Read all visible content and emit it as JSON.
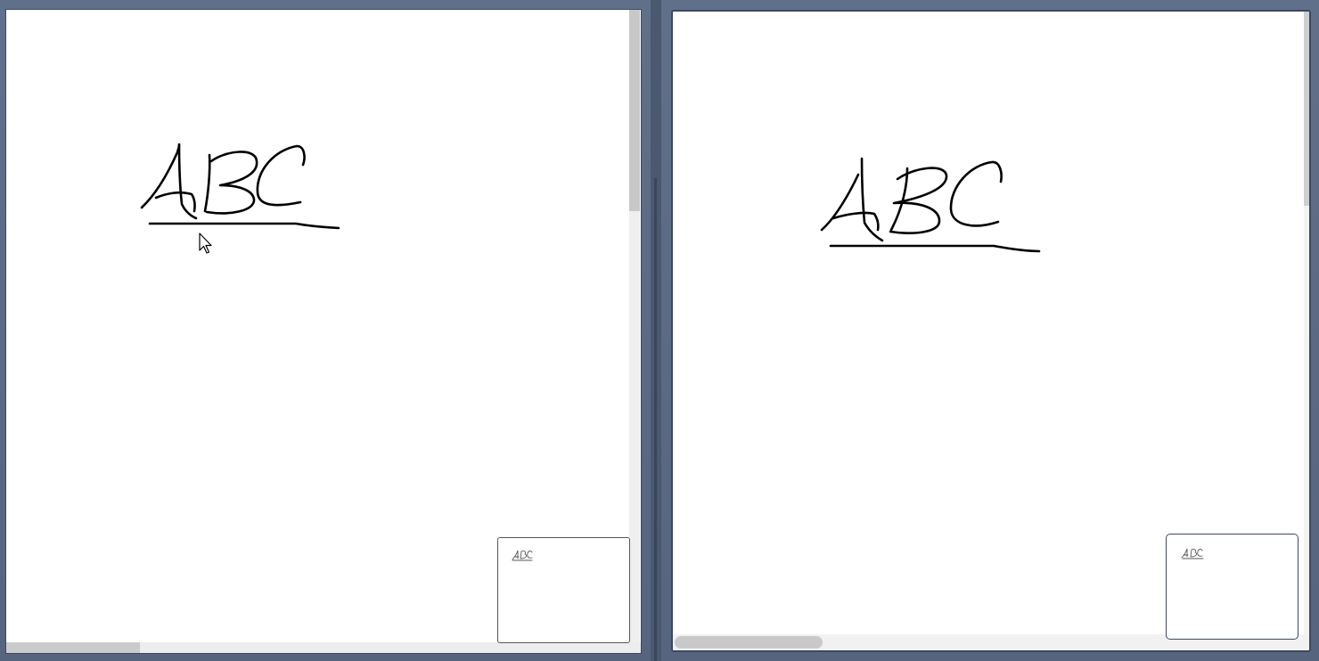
{
  "canvas": {
    "background": "#ffffff",
    "ink_color": "#000000",
    "drawing_icon": "handwritten-abc-drawing"
  },
  "left_view": {
    "minimap_icon": "minimap-abc-thumbnail",
    "cursor_icon": "arrow-pointer-icon"
  },
  "right_view": {
    "minimap_icon": "minimap-abc-thumbnail"
  },
  "colors": {
    "desktop": "#5b6a82",
    "frame_border": "#3d4860",
    "scroll_track": "#ededed",
    "scroll_thumb": "#c8c8c8"
  }
}
